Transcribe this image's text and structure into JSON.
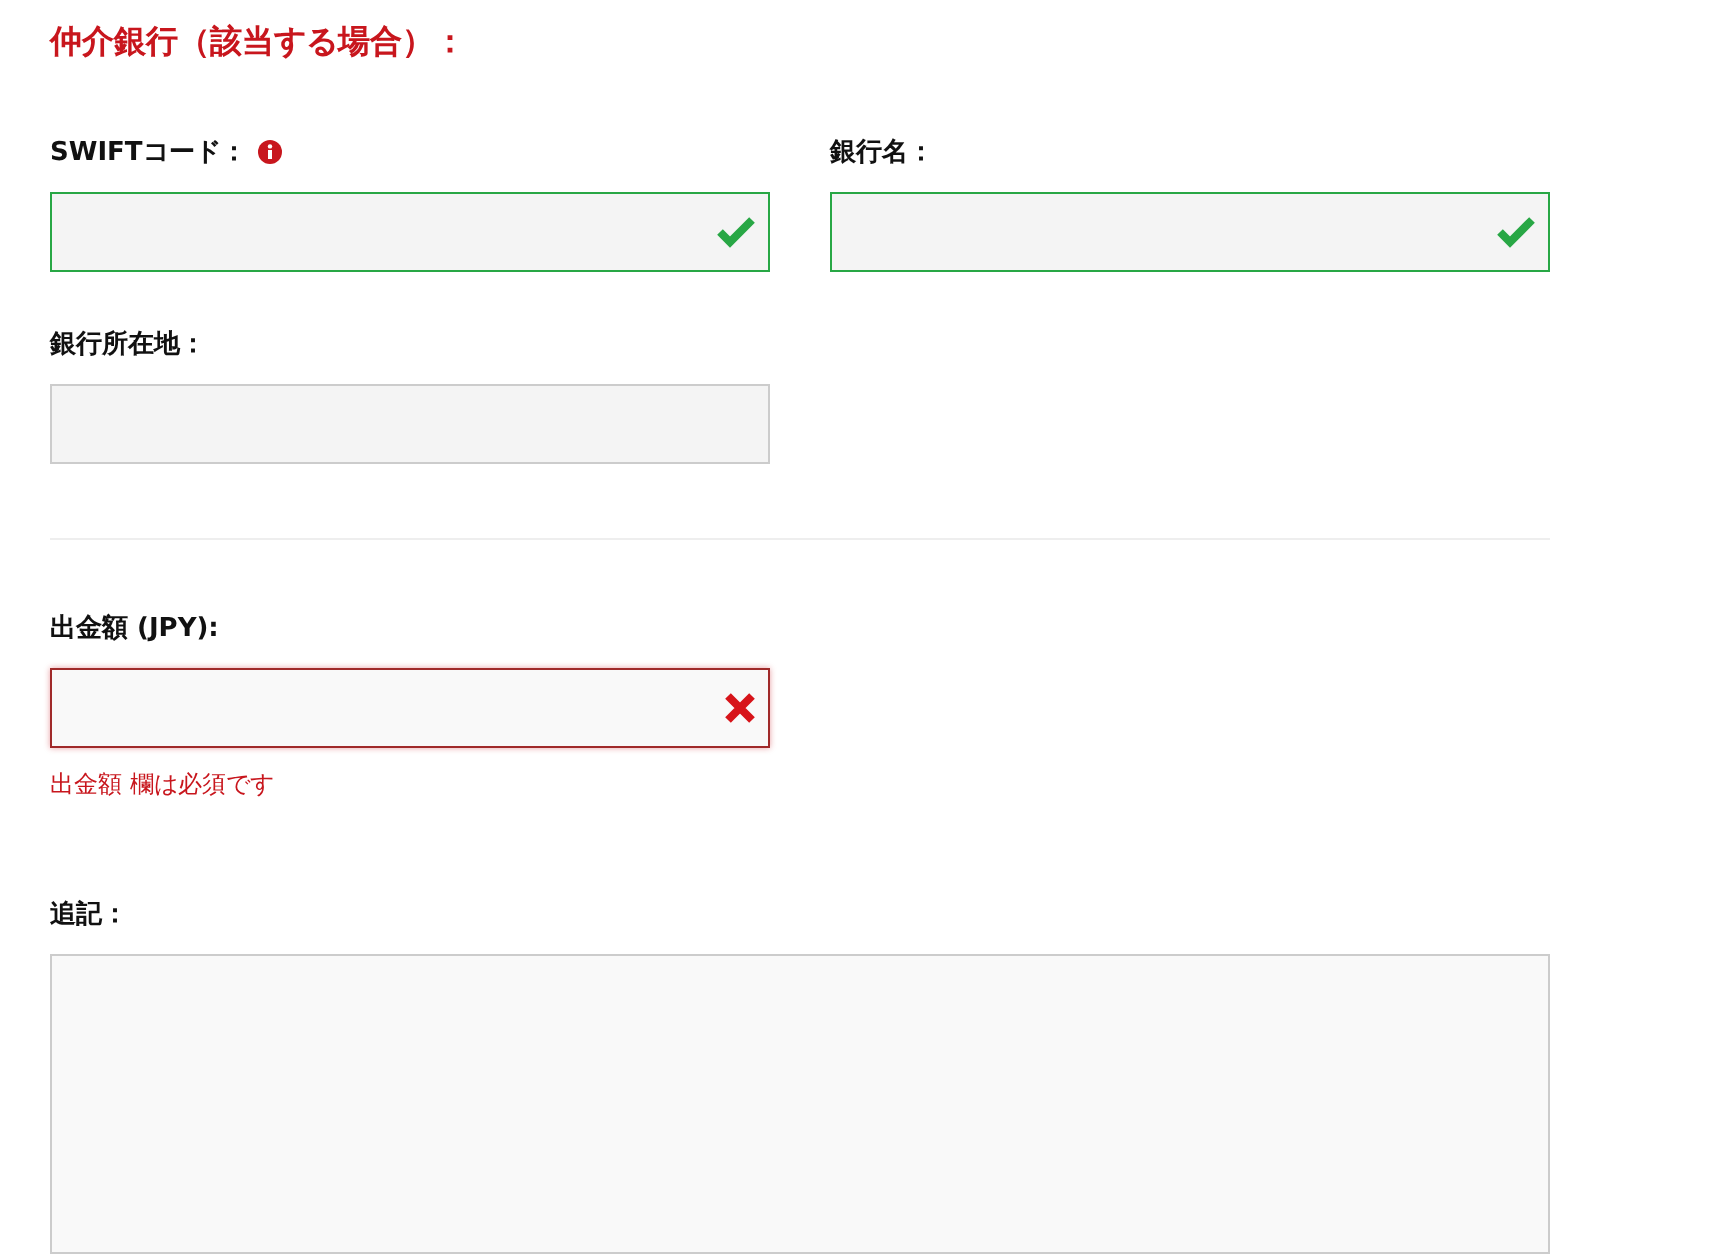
{
  "section_title": "仲介銀行（該当する場合）：",
  "bank_fields": [
    {
      "label": "SWIFTコード：",
      "info": true,
      "valid": true,
      "invalid": false
    },
    {
      "label": "銀行名：",
      "info": false,
      "valid": true,
      "invalid": false
    },
    {
      "label": "銀行所在地：",
      "info": false,
      "valid": false,
      "invalid": false
    }
  ],
  "amount": {
    "label": "出金額 (JPY):",
    "valid": false,
    "invalid": true,
    "error": "出金額 欄は必須です"
  },
  "notes": {
    "label": "追記："
  }
}
